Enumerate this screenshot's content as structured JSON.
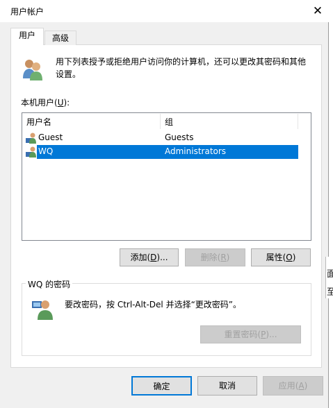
{
  "window": {
    "title": "用户帐户",
    "close_glyph": "✕"
  },
  "tabs": [
    {
      "label": "用户"
    },
    {
      "label": "高级"
    }
  ],
  "intro": {
    "text": "用下列表授予或拒绝用户访问你的计算机，还可以更改其密码和其他设置。"
  },
  "local_users": {
    "label_prefix": "本机用户(",
    "mnemonic": "U",
    "label_suffix": "):"
  },
  "list": {
    "columns": [
      "用户名",
      "组"
    ],
    "rows": [
      {
        "name": "Guest",
        "group": "Guests",
        "selected": false
      },
      {
        "name": "WQ",
        "group": "Administrators",
        "selected": true
      }
    ]
  },
  "buttons": {
    "add": {
      "prefix": "添加(",
      "mnemonic": "D",
      "suffix": ")..."
    },
    "remove": {
      "prefix": "删除(",
      "mnemonic": "R",
      "suffix": ")"
    },
    "properties": {
      "prefix": "属性(",
      "mnemonic": "O",
      "suffix": ")"
    },
    "reset": {
      "prefix": "重置密码(",
      "mnemonic": "P",
      "suffix": ")..."
    },
    "ok": "确定",
    "cancel": "取消",
    "apply": {
      "prefix": "应用(",
      "mnemonic": "A",
      "suffix": ")"
    }
  },
  "password_group": {
    "label": "WQ 的密码",
    "text": "要改密码，按 Ctrl-Alt-Del 并选择“更改密码”。"
  },
  "background_fragments": [
    "面",
    "至"
  ],
  "colors": {
    "selection": "#0078d7",
    "default_button_border": "#0078d7"
  }
}
